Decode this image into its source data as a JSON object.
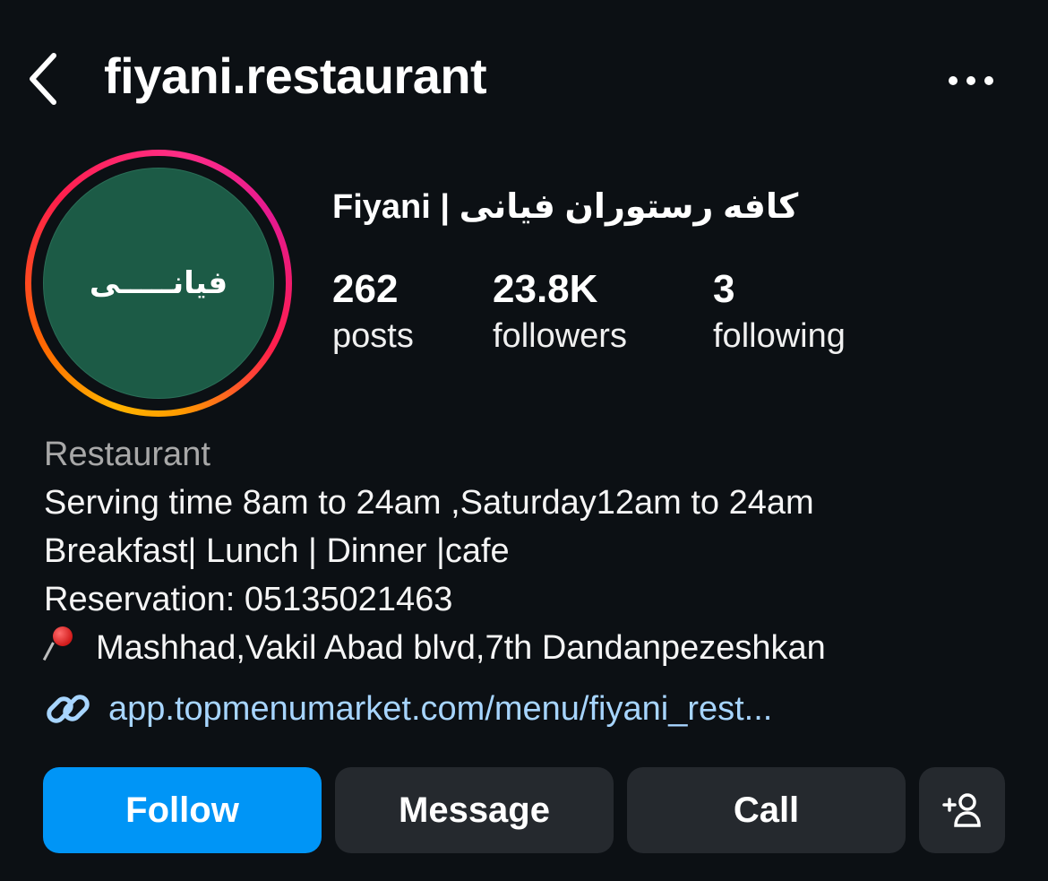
{
  "header": {
    "username": "fiyani.restaurant",
    "back_icon": "chevron-left-icon",
    "more_icon": "more-horizontal-icon"
  },
  "profile": {
    "avatar_text": "فیانـــــی",
    "display_name": "Fiyani | کافه رستوران فیانی",
    "story_ring_colors": [
      "#ffb400",
      "#ff6a00",
      "#ff1f4b",
      "#e5198f"
    ],
    "avatar_bg": "#1c5b46"
  },
  "stats": {
    "posts": {
      "value": "262",
      "label": "posts"
    },
    "followers": {
      "value": "23.8K",
      "label": "followers"
    },
    "following": {
      "value": "3",
      "label": "following"
    }
  },
  "bio": {
    "category": "Restaurant",
    "lines": [
      "Serving time 8am to 24am ,Saturday12am to 24am",
      "Breakfast| Lunch | Dinner |cafe",
      "Reservation: 05135021463"
    ],
    "location": "Mashhad,Vakil Abad blvd,7th Dandanpezeshkan",
    "location_icon": "round-pushpin-icon",
    "link": "app.topmenumarket.com/menu/fiyani_rest...",
    "link_icon": "link-icon"
  },
  "actions": {
    "follow": "Follow",
    "message": "Message",
    "call": "Call",
    "suggest_icon": "add-person-icon",
    "follow_color": "#0095f6",
    "secondary_color": "#25292e"
  }
}
